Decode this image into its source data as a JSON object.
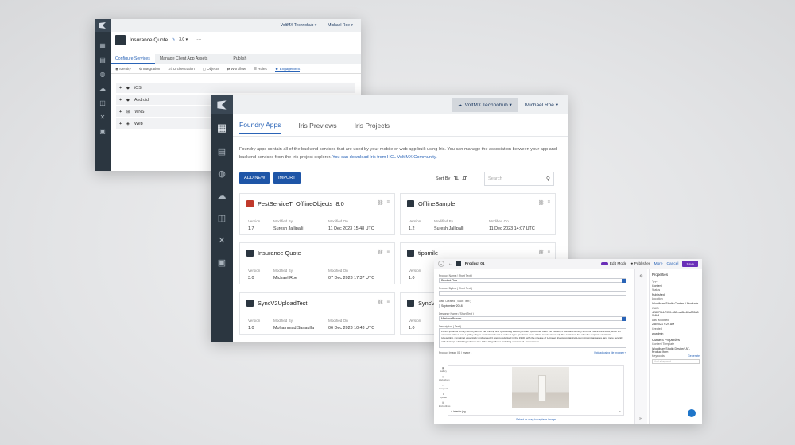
{
  "background": {
    "color": "#e4e5e7"
  },
  "win1": {
    "cloud": "VoltMX Technohub ▾",
    "user": "Michael Roe ▾",
    "app_title": "Insurance Quote",
    "version": "3.0 ▾",
    "more": "···",
    "tabs": [
      "Configure Services",
      "Manage Client App Assets",
      "Publish"
    ],
    "subtabs": [
      "Identity",
      "Integration",
      "Orchestration",
      "Objects",
      "Workflow",
      "Rules",
      "Engagement"
    ],
    "rows": [
      "iOS",
      "Android",
      "WNS",
      "Web"
    ]
  },
  "win2": {
    "cloud": "VoltMX Technohub ▾",
    "user": "Michael Roe ▾",
    "tabs": [
      "Foundry Apps",
      "Iris Previews",
      "Iris Projects"
    ],
    "description": "Foundry apps contain all of the backend services that are used by your mobile or web app built using Iris. You can manage the association between your app and backend services from the Iris project explorer.",
    "link": "You can download Iris from HCL Volt MX Community.",
    "add_new": "ADD NEW",
    "import": "IMPORT",
    "sort_by": "Sort By",
    "search_placeholder": "Search",
    "labels": {
      "version": "Version",
      "modified_by": "Modified By",
      "modified_on": "Modified On"
    },
    "cards": [
      {
        "name": "PestServiceT_OfflineObjects_8.0",
        "version": "1.7",
        "by": "Suresh Jallipalli",
        "on": "11 Dec 2023 15:48 UTC"
      },
      {
        "name": "OfflineSample",
        "version": "1.2",
        "by": "Suresh Jallipalli",
        "on": "11 Dec 2023 14:07 UTC"
      },
      {
        "name": "Insurance Quote",
        "version": "3.0",
        "by": "Michael Roe",
        "on": "07 Dec 2023 17:37 UTC"
      },
      {
        "name": "tipsmile",
        "version": "1.0",
        "by": "",
        "on": ""
      },
      {
        "name": "SyncV2UploadTest",
        "version": "1.0",
        "by": "Mohammad Sanaulla",
        "on": "06 Dec 2023 10:43 UTC"
      },
      {
        "name": "SyncV",
        "version": "1.0",
        "by": "",
        "on": ""
      }
    ]
  },
  "win3": {
    "title": "Product 01",
    "edit_mode": "Edit Mode",
    "publisher": "Publisher",
    "more": "More",
    "cancel": "Cancel",
    "save": "Save",
    "fields": [
      {
        "label": "Product Name ( Short Text )",
        "value": "Product One"
      },
      {
        "label": "Product Byline ( Short Text )",
        "value": ""
      },
      {
        "label": "Date Created ( Short Text )",
        "value": "September 2018"
      },
      {
        "label": "Designer Name ( Short Text )",
        "value": "Mariana Brewer"
      }
    ],
    "desc_label": "Description ( Text )",
    "desc_text": "Lorem Ipsum is simply dummy text of the printing and typesetting industry. Lorem Ipsum has been the industry's standard dummy text ever since the 1500s, when an unknown printer took a galley of type and scrambled it to make a type specimen book. It has survived not only five centuries, but also the leap into electronic typesetting, remaining essentially unchanged. It was popularised in the 1960s with the release of Letraset sheets containing Lorem Ipsum passages, and more recently with desktop publishing software like Aldus PageMaker including versions of Lorem Ipsum.",
    "image_label": "Product Image 01 ( Image )",
    "upload": "Upload using file browser ▾",
    "image_tools": [
      "Gallery",
      "WebAlbum",
      "Unsplash",
      "Upload",
      "Embedlinks"
    ],
    "file_name": "4-interior.jpg",
    "replace": "Select or drag to replace image",
    "properties": {
      "heading": "Properties",
      "type_label": "Type",
      "type": "Content",
      "status_label": "Status",
      "status": "Published",
      "location_label": "Location",
      "location": "Woodbum Studio Content / Products",
      "uuid_label": "UUID",
      "uuid": "42807f64-7950-48fb-a48b-80c805687f4b4",
      "modified_label": "Last Modified",
      "modified": "2/8/2021 9:29 AM",
      "created_label": "Created",
      "created": "wpadmin",
      "content_heading": "Content Properties",
      "ct_label": "Content Template",
      "ct": "Woodbum Studio Design / AT-Product Item",
      "keywords_label": "Keywords",
      "generate": "Generate",
      "add_keyword": "Add a keyword"
    }
  }
}
